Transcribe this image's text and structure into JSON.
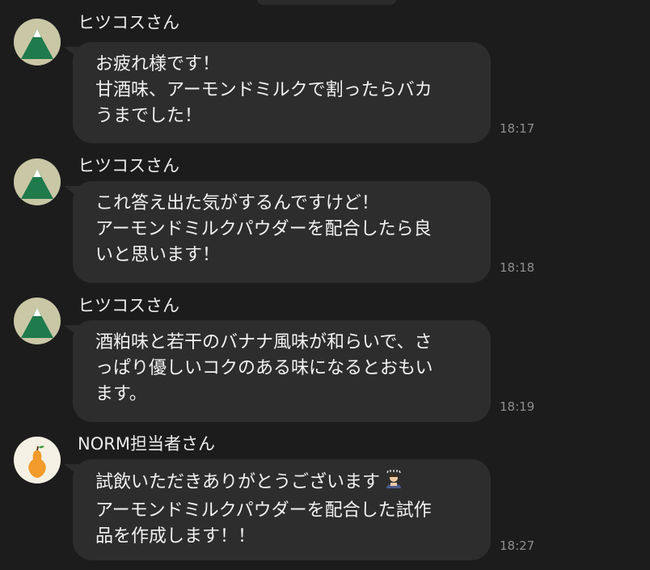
{
  "messages": [
    {
      "sender": "ヒツコスさん",
      "avatar": "mountain-avatar-icon",
      "lines": [
        "お疲れ様です！",
        "甘酒味、アーモンドミルクで割ったらバカ",
        "うまでした！"
      ],
      "time": "18:17"
    },
    {
      "sender": "ヒツコスさん",
      "avatar": "mountain-avatar-icon",
      "lines": [
        "これ答え出た気がするんですけど！",
        "アーモンドミルクパウダーを配合したら良",
        "いと思います！"
      ],
      "time": "18:18"
    },
    {
      "sender": "ヒツコスさん",
      "avatar": "mountain-avatar-icon",
      "lines": [
        "酒粕味と若干のバナナ風味が和らいで、さ",
        "っぱり優しいコクのある味になるとおもい",
        "ます。"
      ],
      "time": "18:19"
    },
    {
      "sender": "NORM担当者さん",
      "avatar": "pear-avatar-icon",
      "lines": [
        "試飲いただきありがとうございます",
        "アーモンドミルクパウダーを配合した試作",
        "品を作成します！！"
      ],
      "emoji": "bowing-person-emoji",
      "time": "18:27"
    }
  ],
  "colors": {
    "background": "#1c1c1c",
    "bubble": "#2d2d2d",
    "text": "#f2f2f2",
    "timestamp": "#8e8e8e",
    "mountain_green": "#1f7a4c",
    "mountain_bg": "#c9c7a6",
    "pear_orange": "#f39a2c"
  }
}
